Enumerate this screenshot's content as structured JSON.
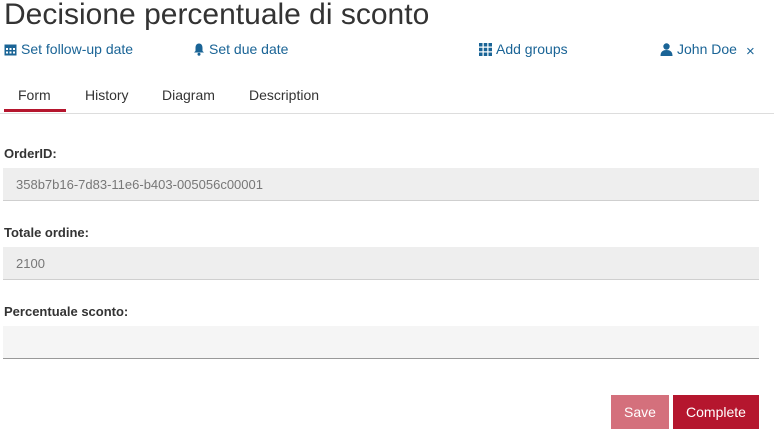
{
  "page": {
    "title": "Decisione percentuale di sconto"
  },
  "actions": {
    "follow_up": "Set follow-up date",
    "due_date": "Set due date",
    "add_groups": "Add groups",
    "assignee": "John Doe",
    "close": "×"
  },
  "tabs": [
    {
      "label": "Form",
      "active": true
    },
    {
      "label": "History",
      "active": false
    },
    {
      "label": "Diagram",
      "active": false
    },
    {
      "label": "Description",
      "active": false
    }
  ],
  "form": {
    "fields": [
      {
        "label": "OrderID:",
        "value": "358b7b16-7d83-11e6-b403-005056c00001",
        "readonly": true
      },
      {
        "label": "Totale ordine:",
        "value": "2100",
        "readonly": true
      },
      {
        "label": "Percentuale sconto:",
        "value": "",
        "readonly": false
      }
    ]
  },
  "buttons": {
    "save": "Save",
    "complete": "Complete"
  },
  "colors": {
    "accent": "#b5162e",
    "link": "#1a6496",
    "save_disabled": "#d4707c"
  },
  "icons": [
    "calendar-icon",
    "bell-icon",
    "grid-icon",
    "user-icon",
    "close-icon"
  ]
}
